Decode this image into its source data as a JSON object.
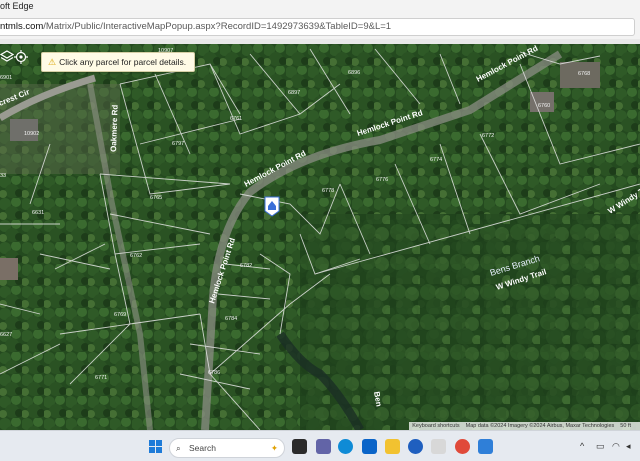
{
  "window": {
    "title_fragment": "oft Edge"
  },
  "address_bar": {
    "url_host": "ntmls.com",
    "url_path": "/Matrix/Public/InteractiveMapPopup.aspx?RecordID=1492973639&TableID=9&L=1"
  },
  "map_toolbar": {
    "layers_icon": "layers-icon",
    "locate_icon": "crosshair-target-icon",
    "tooltip_text": "Click any parcel for parcel details."
  },
  "roads": {
    "hemlock_point_rd_north": "Hemlock Point Rd",
    "hemlock_point_rd_mid": "Hemlock Point Rd",
    "hemlock_point_rd_curve": "Hemlock Point Rd",
    "hemlock_point_rd_south": "Hemlock Point Rd",
    "oakmere_rd": "Oakmere Rd",
    "crest_cir": "crest Cir",
    "w_windy": "W Windy T",
    "w_windy_trail": "W Windy Trail",
    "bens_branch_south": "Ben"
  },
  "streams": {
    "bens_branch": "Bens Branch"
  },
  "parcels": [
    "10907",
    "6896",
    "6897",
    "6768",
    "6760",
    "6761",
    "6797",
    "6772",
    "6774",
    "6776",
    "6778",
    "6765",
    "6782",
    "6784",
    "6786",
    "6762",
    "6769",
    "6771",
    "6627",
    "6631",
    "10902",
    "33",
    "6901"
  ],
  "attribution": {
    "shortcuts": "Keyboard shortcuts",
    "map_data": "Map data ©2024 Imagery ©2024 Airbus, Maxar Technologies",
    "scale": "50 ft"
  },
  "taskbar": {
    "search_label": "Search",
    "tray_chevron": "^"
  }
}
